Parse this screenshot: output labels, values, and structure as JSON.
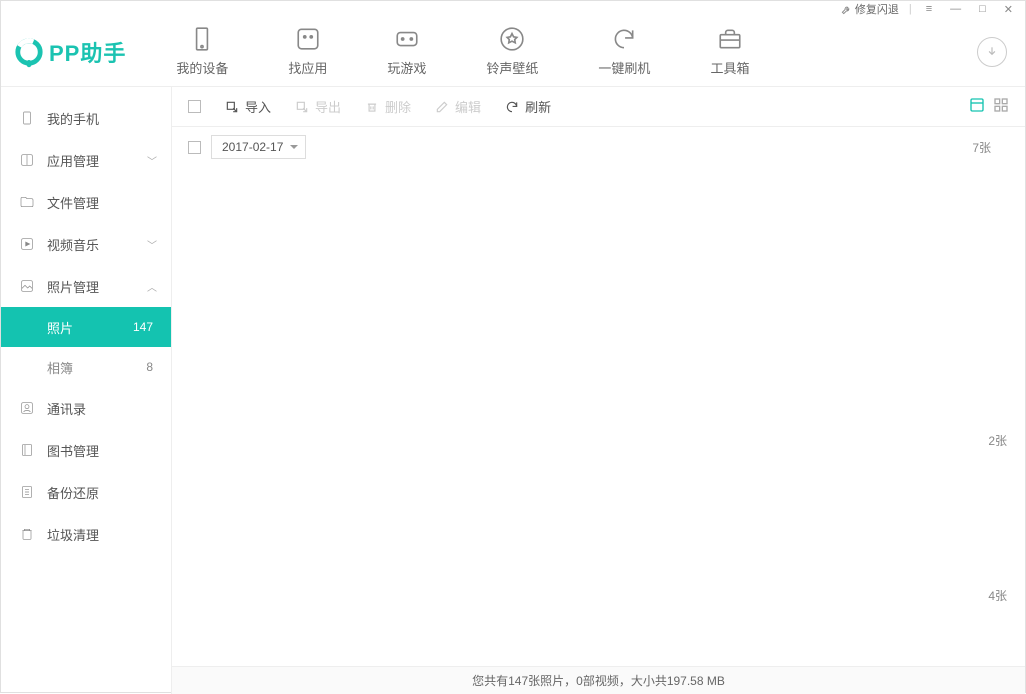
{
  "titlebar": {
    "fix_crash": "修复闪退",
    "menu": "≡",
    "minimize": "—",
    "maximize": "□",
    "close": "✕"
  },
  "logo": {
    "text": "PP助手"
  },
  "topnav": [
    {
      "label": "我的设备"
    },
    {
      "label": "找应用"
    },
    {
      "label": "玩游戏"
    },
    {
      "label": "铃声壁纸"
    },
    {
      "label": "一键刷机"
    },
    {
      "label": "工具箱"
    }
  ],
  "sidebar": {
    "my_phone": "我的手机",
    "app_manage": "应用管理",
    "file_manage": "文件管理",
    "video_music": "视频音乐",
    "photo_manage": "照片管理",
    "photos": {
      "label": "照片",
      "count": "147"
    },
    "albums": {
      "label": "相簿",
      "count": "8"
    },
    "contacts": "通讯录",
    "books": "图书管理",
    "backup": "备份还原",
    "cleanup": "垃圾清理"
  },
  "toolbar": {
    "import": "导入",
    "export": "导出",
    "delete": "删除",
    "edit": "编辑",
    "refresh": "刷新"
  },
  "groups": [
    {
      "date": "2017-02-17",
      "count": "7张"
    },
    {
      "count": "2张"
    },
    {
      "count": "4张"
    }
  ],
  "status": "您共有147张照片，0部视频，大小共197.58 MB"
}
